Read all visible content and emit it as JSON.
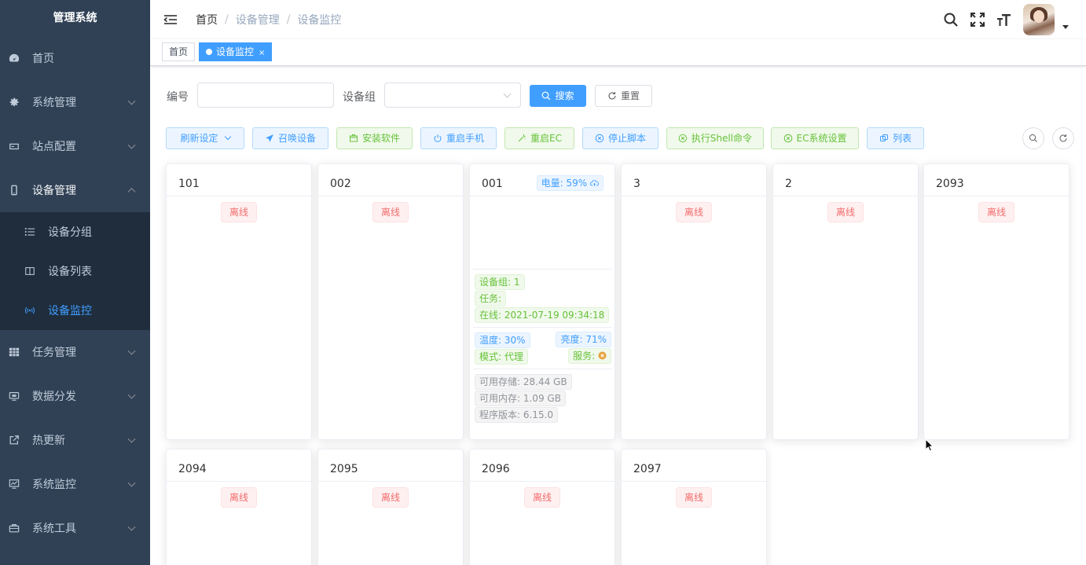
{
  "app": {
    "title": "管理系统"
  },
  "sidebar": {
    "items": [
      {
        "label": "首页",
        "icon": "dashboard-icon"
      },
      {
        "label": "系统管理",
        "icon": "gear-icon"
      },
      {
        "label": "站点配置",
        "icon": "monitor-small-icon"
      },
      {
        "label": "设备管理",
        "icon": "phone-icon"
      },
      {
        "label": "任务管理",
        "icon": "table-grid-icon"
      },
      {
        "label": "数据分发",
        "icon": "screen-icon"
      },
      {
        "label": "热更新",
        "icon": "external-link-icon"
      },
      {
        "label": "系统监控",
        "icon": "chart-monitor-icon"
      },
      {
        "label": "系统工具",
        "icon": "toolbox-icon"
      }
    ],
    "submenu": [
      {
        "label": "设备分组",
        "icon": "list-icon"
      },
      {
        "label": "设备列表",
        "icon": "book-icon"
      },
      {
        "label": "设备监控",
        "icon": "signal-icon",
        "active": true
      }
    ]
  },
  "navbar": {
    "breadcrumb": [
      "首页",
      "设备管理",
      "设备监控"
    ],
    "separator": "/"
  },
  "tags": [
    {
      "label": "首页",
      "active": false
    },
    {
      "label": "设备监控",
      "active": true,
      "close": "×"
    }
  ],
  "search": {
    "code_label": "编号",
    "code_value": "",
    "group_label": "设备组",
    "group_value": "",
    "search_button": "搜索",
    "reset_button": "重置"
  },
  "toolbar": {
    "refresh": "刷新设定",
    "summon": "召唤设备",
    "install": "安装软件",
    "restart_phone": "重启手机",
    "restart_ec": "重启EC",
    "stop_script": "停止脚本",
    "exec_shell": "执行Shell命令",
    "ec_settings": "EC系统设置",
    "list": "列表"
  },
  "devices": [
    {
      "code": "101",
      "status": "离线"
    },
    {
      "code": "002",
      "status": "离线"
    },
    {
      "code": "001",
      "battery": "电量: 59%",
      "group": "设备组: 1",
      "task": "任务:",
      "online": "在线: 2021-07-19 09:34:18",
      "temperature": "温度: 30%",
      "brightness": "亮度: 71%",
      "mode": "模式: 代理",
      "service": "服务:",
      "storage": "可用存储: 28.44 GB",
      "memory": "可用内存: 1.09 GB",
      "version": "程序版本: 6.15.0"
    },
    {
      "code": "3",
      "status": "离线"
    },
    {
      "code": "2",
      "status": "离线"
    },
    {
      "code": "2093",
      "status": "离线"
    },
    {
      "code": "2094",
      "status": "离线"
    },
    {
      "code": "2095",
      "status": "离线"
    },
    {
      "code": "2096",
      "status": "离线"
    },
    {
      "code": "2097",
      "status": "离线"
    }
  ],
  "colors": {
    "sidebar_bg": "#304156",
    "submenu_bg": "#1f2d3d",
    "primary": "#409eff",
    "success": "#67c23a",
    "danger": "#f56c6c",
    "info": "#909399"
  }
}
